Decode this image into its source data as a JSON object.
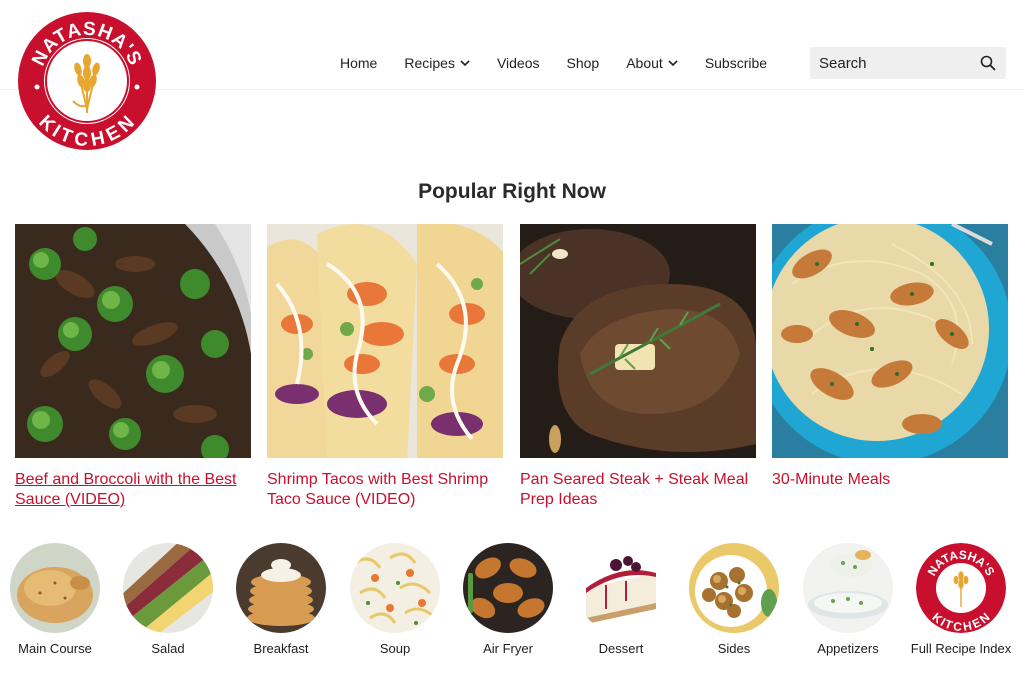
{
  "brand": {
    "logo_text_top": "NATASHA'S",
    "logo_text_bottom": "KITCHEN",
    "brand_color": "#c8102e",
    "accent_gold": "#e8a530"
  },
  "nav": {
    "items": [
      {
        "label": "Home",
        "dropdown": false
      },
      {
        "label": "Recipes",
        "dropdown": true
      },
      {
        "label": "Videos",
        "dropdown": false
      },
      {
        "label": "Shop",
        "dropdown": false
      },
      {
        "label": "About",
        "dropdown": true
      },
      {
        "label": "Subscribe",
        "dropdown": false
      }
    ],
    "search": {
      "placeholder": "Search",
      "icon": "search-icon"
    }
  },
  "popular": {
    "title": "Popular Right Now",
    "cards": [
      {
        "title": "Beef and Broccoli with the Best Sauce (VIDEO)",
        "image": "beef-broccoli-photo",
        "underlined": true
      },
      {
        "title": "Shrimp Tacos with Best Shrimp Taco Sauce (VIDEO)",
        "image": "shrimp-tacos-photo",
        "underlined": false
      },
      {
        "title": "Pan Seared Steak + Steak Meal Prep Ideas",
        "image": "seared-steak-photo",
        "underlined": false
      },
      {
        "title": "30-Minute Meals",
        "image": "chicken-pasta-photo",
        "underlined": false
      }
    ]
  },
  "categories": [
    {
      "label": "Main Course",
      "image": "roast-chicken-photo"
    },
    {
      "label": "Salad",
      "image": "cobb-salad-photo"
    },
    {
      "label": "Breakfast",
      "image": "pancakes-photo"
    },
    {
      "label": "Soup",
      "image": "noodle-soup-photo"
    },
    {
      "label": "Air Fryer",
      "image": "chicken-wings-photo"
    },
    {
      "label": "Dessert",
      "image": "cheesecake-photo"
    },
    {
      "label": "Sides",
      "image": "roasted-potatoes-photo"
    },
    {
      "label": "Appetizers",
      "image": "dip-photo"
    },
    {
      "label": "Full Recipe Index",
      "image": "logo-badge"
    }
  ]
}
